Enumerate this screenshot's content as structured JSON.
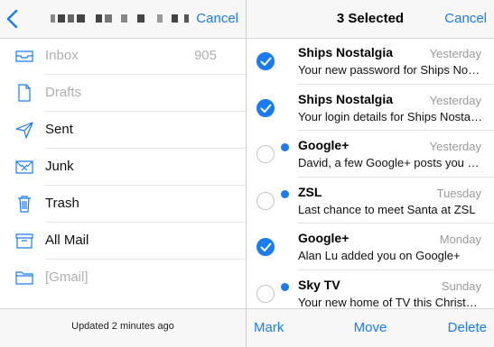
{
  "left": {
    "header": {
      "account_name_redacted": true,
      "cancel_label": "Cancel"
    },
    "folders": [
      {
        "label": "Inbox",
        "count": "905",
        "icon": "inbox-icon"
      },
      {
        "label": "Drafts",
        "count": "",
        "icon": "drafts-icon"
      },
      {
        "label": "Sent",
        "count": "",
        "icon": "sent-icon"
      },
      {
        "label": "Junk",
        "count": "",
        "icon": "junk-icon"
      },
      {
        "label": "Trash",
        "count": "",
        "icon": "trash-icon"
      },
      {
        "label": "All Mail",
        "count": "",
        "icon": "archive-icon"
      },
      {
        "label": "[Gmail]",
        "count": "",
        "icon": "folder-icon"
      }
    ],
    "footer": {
      "status": "Updated 2 minutes ago"
    }
  },
  "right": {
    "header": {
      "title": "3 Selected",
      "cancel_label": "Cancel"
    },
    "messages": [
      {
        "from": "Ships Nostalgia",
        "date": "Yesterday",
        "preview": "Your new password for Ships Nostalgia",
        "selected": true,
        "unread": false
      },
      {
        "from": "Ships Nostalgia",
        "date": "Yesterday",
        "preview": "Your login details for Ships Nostalgia",
        "selected": true,
        "unread": false
      },
      {
        "from": "Google+",
        "date": "Yesterday",
        "preview": "David, a few Google+ posts you might like",
        "selected": false,
        "unread": true
      },
      {
        "from": "ZSL",
        "date": "Tuesday",
        "preview": "Last chance to meet Santa at ZSL",
        "selected": false,
        "unread": true
      },
      {
        "from": "Google+",
        "date": "Monday",
        "preview": "Alan Lu added you on Google+",
        "selected": true,
        "unread": false
      },
      {
        "from": "Sky TV",
        "date": "Sunday",
        "preview": "Your new home of TV this Christmas",
        "selected": false,
        "unread": true
      }
    ],
    "footer": {
      "mark_label": "Mark",
      "move_label": "Move",
      "delete_label": "Delete"
    }
  },
  "colors": {
    "accent": "#1a7cf5",
    "muted_text": "#b0b0b0",
    "date_text": "#9a9a9a"
  }
}
